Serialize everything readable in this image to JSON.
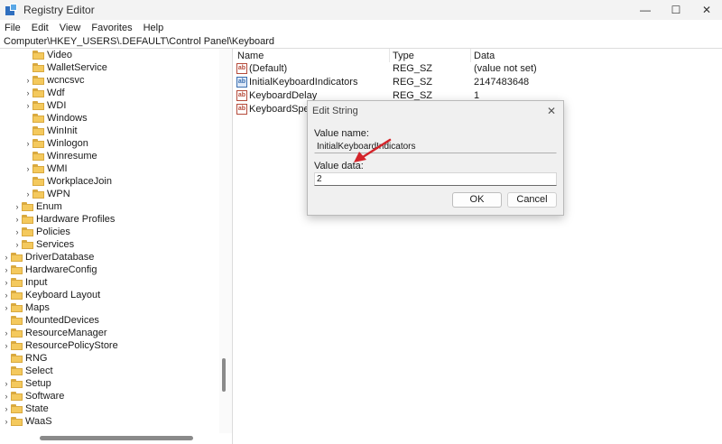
{
  "window": {
    "title": "Registry Editor",
    "minimize": "—",
    "maximize": "☐",
    "close": "✕"
  },
  "menu": [
    "File",
    "Edit",
    "View",
    "Favorites",
    "Help"
  ],
  "address": "Computer\\HKEY_USERS\\.DEFAULT\\Control Panel\\Keyboard",
  "tree": [
    {
      "label": "Video",
      "expander": ""
    },
    {
      "label": "WalletService",
      "expander": ""
    },
    {
      "label": "wcncsvc",
      "expander": "›"
    },
    {
      "label": "Wdf",
      "expander": "›"
    },
    {
      "label": "WDI",
      "expander": "›"
    },
    {
      "label": "Windows",
      "expander": ""
    },
    {
      "label": "WinInit",
      "expander": ""
    },
    {
      "label": "Winlogon",
      "expander": "›"
    },
    {
      "label": "Winresume",
      "expander": ""
    },
    {
      "label": "WMI",
      "expander": "›"
    },
    {
      "label": "WorkplaceJoin",
      "expander": ""
    },
    {
      "label": "WPN",
      "expander": "›"
    },
    {
      "label": "Enum",
      "expander": "›"
    },
    {
      "label": "Hardware Profiles",
      "expander": "›"
    },
    {
      "label": "Policies",
      "expander": "›"
    },
    {
      "label": "Services",
      "expander": "›"
    },
    {
      "label": "DriverDatabase",
      "expander": "›"
    },
    {
      "label": "HardwareConfig",
      "expander": "›"
    },
    {
      "label": "Input",
      "expander": "›"
    },
    {
      "label": "Keyboard Layout",
      "expander": "›"
    },
    {
      "label": "Maps",
      "expander": "›"
    },
    {
      "label": "MountedDevices",
      "expander": ""
    },
    {
      "label": "ResourceManager",
      "expander": "›"
    },
    {
      "label": "ResourcePolicyStore",
      "expander": "›"
    },
    {
      "label": "RNG",
      "expander": ""
    },
    {
      "label": "Select",
      "expander": ""
    },
    {
      "label": "Setup",
      "expander": "›"
    },
    {
      "label": "Software",
      "expander": "›"
    },
    {
      "label": "State",
      "expander": "›"
    },
    {
      "label": "WaaS",
      "expander": "›"
    }
  ],
  "columns": {
    "name": "Name",
    "type": "Type",
    "data": "Data"
  },
  "values": [
    {
      "name": "(Default)",
      "type": "REG_SZ",
      "data": "(value not set)",
      "icon": "ab"
    },
    {
      "name": "InitialKeyboardIndicators",
      "type": "REG_SZ",
      "data": "2147483648",
      "icon": "ab"
    },
    {
      "name": "KeyboardDelay",
      "type": "REG_SZ",
      "data": "1",
      "icon": "ab"
    },
    {
      "name": "KeyboardSpeed",
      "type": "",
      "data": "",
      "icon": "ab"
    }
  ],
  "dialog": {
    "title": "Edit String",
    "close": "✕",
    "value_name_label": "Value name:",
    "value_name": "InitialKeyboardIndicators",
    "value_data_label": "Value data:",
    "value_data": "2",
    "ok": "OK",
    "cancel": "Cancel"
  },
  "colors": {
    "annotation_arrow": "#d4242a",
    "folder": "#f4c95d"
  }
}
